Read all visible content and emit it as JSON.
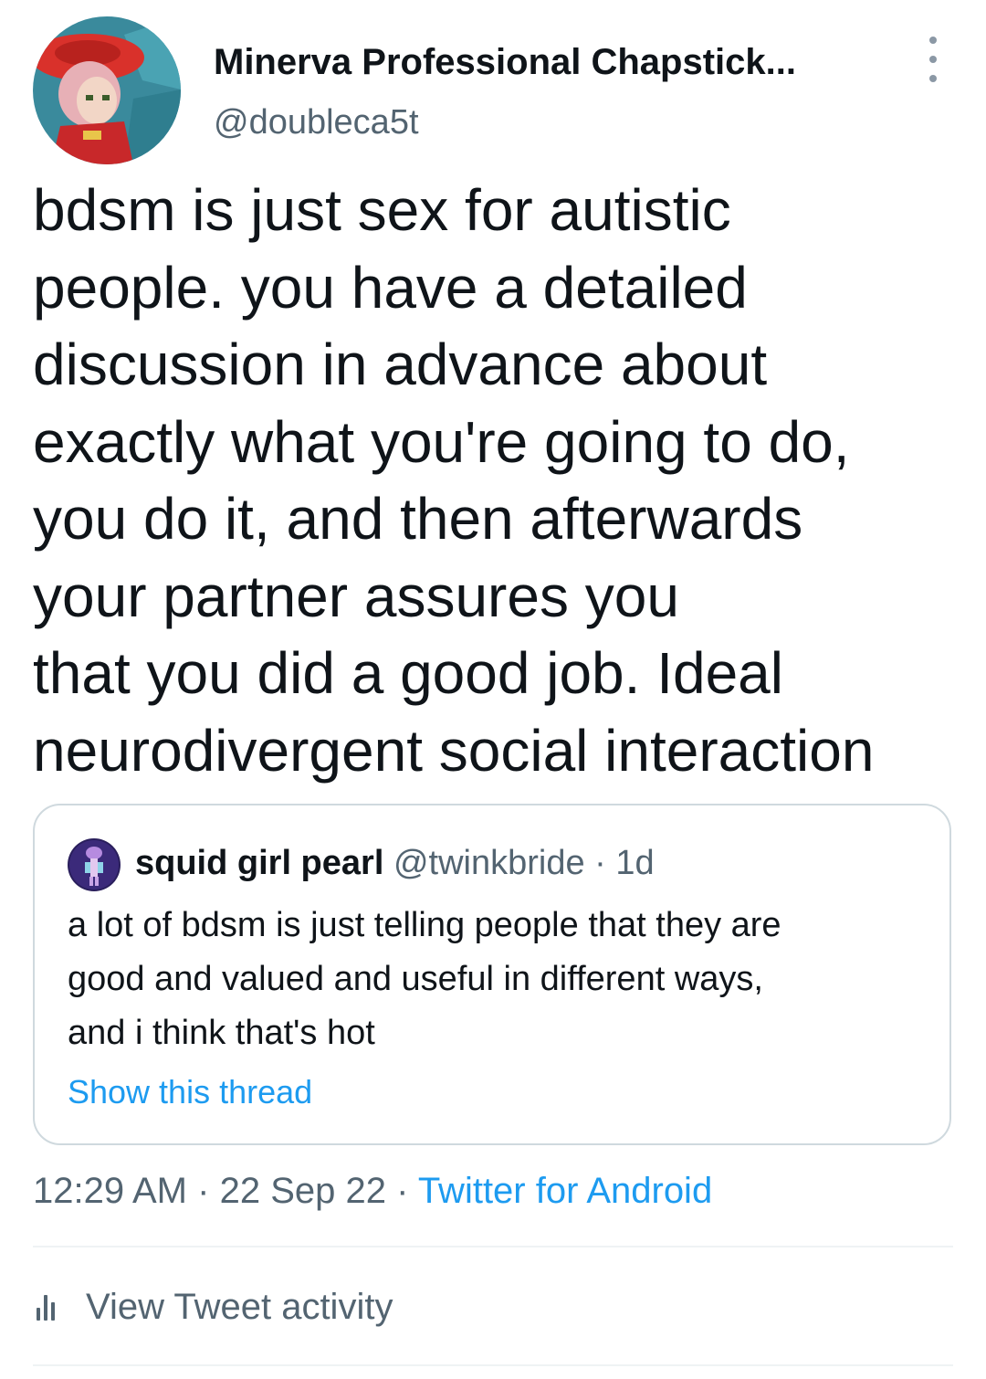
{
  "author": {
    "display_name": "Minerva Professional Chapstick...",
    "handle": "@doubleca5t"
  },
  "tweet": {
    "lines": [
      "bdsm is just sex for autistic",
      "people. you have a detailed",
      "discussion in advance about",
      "exactly what you're going to do,",
      "you do it, and then afterwards",
      "your partner assures you",
      "that you did a good job. Ideal",
      "neurodivergent social interaction"
    ]
  },
  "quote": {
    "display_name": "squid girl pearl",
    "handle": "@twinkbride",
    "separator": "·",
    "time": "1d",
    "lines": [
      "a lot of bdsm is just telling people that they are",
      "good and valued and useful in different ways,",
      "and i think that's hot"
    ],
    "show_thread": "Show this thread"
  },
  "meta": {
    "time": "12:29 AM",
    "separator": "·",
    "date": "22 Sep 22",
    "source": "Twitter for Android"
  },
  "activity": {
    "label": "View Tweet activity"
  },
  "icons": {
    "more": "more-vertical-icon",
    "activity": "bar-chart-icon"
  },
  "colors": {
    "text": "#0f1419",
    "secondary": "#536471",
    "link": "#1d9bf0",
    "border": "#cfd9de"
  }
}
